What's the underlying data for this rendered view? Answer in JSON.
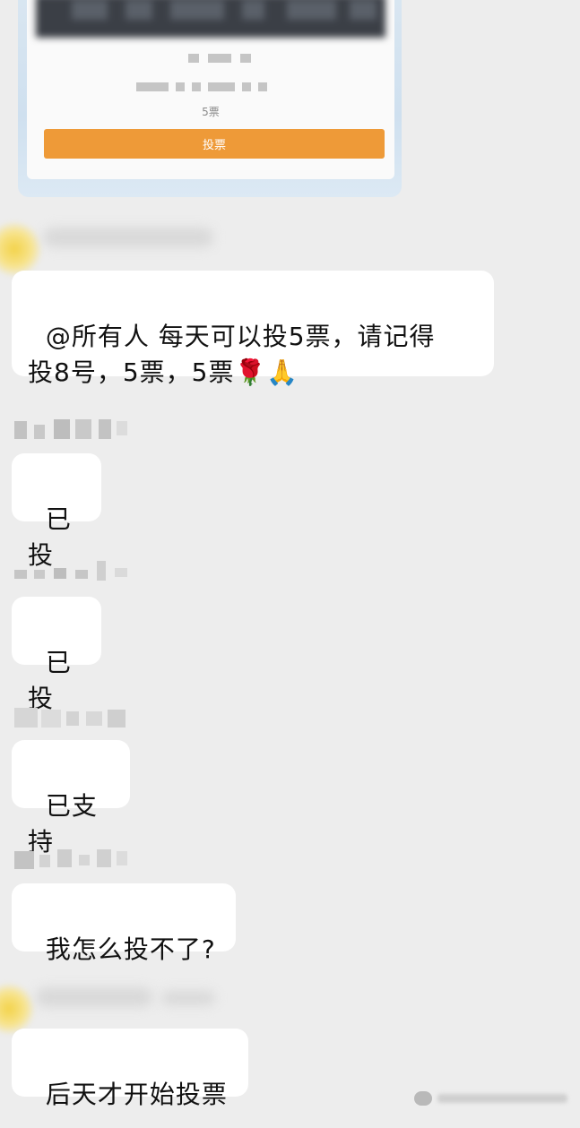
{
  "vote_card": {
    "votes_text": "5票",
    "vote_button_label": "投票"
  },
  "messages": [
    {
      "text": "@所有人 每天可以投5票，请记得\n投8号，5票，5票",
      "emojis": "🌹🙏"
    },
    {
      "text": "已投"
    },
    {
      "text": "已投"
    },
    {
      "text": "已支持"
    },
    {
      "text": "我怎么投不了?"
    },
    {
      "text": "后天才开始投票"
    }
  ],
  "colors": {
    "background": "#ededed",
    "bubble": "#ffffff",
    "vote_button": "#ee9a38",
    "card_frame": "#cfe0ef"
  },
  "icons": [
    "wechat-watermark-icon"
  ]
}
